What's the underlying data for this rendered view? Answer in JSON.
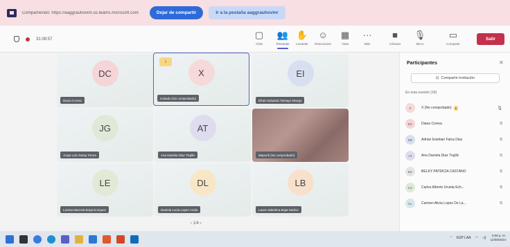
{
  "share_bar": {
    "text": "Compartiendo: https://aaggrauhovinr.us.teams.microsoft.com",
    "stop_label": "Dejar de compartir",
    "goto_label": "Ir a la pestaña aaggrauhovinr"
  },
  "toolbar": {
    "timer": "31:08:57",
    "items": [
      {
        "icon": "chat-icon",
        "glyph": "▢",
        "label": "Chat"
      },
      {
        "icon": "people-icon",
        "glyph": "👥",
        "label": "Personas"
      },
      {
        "icon": "raise-hand-icon",
        "glyph": "✋",
        "label": "Levantar"
      },
      {
        "icon": "reactions-icon",
        "glyph": "☺",
        "label": "Reacciones"
      },
      {
        "icon": "view-icon",
        "glyph": "▦",
        "label": "Vista"
      },
      {
        "icon": "more-icon",
        "glyph": "···",
        "label": "Más"
      },
      {
        "icon": "camera-icon",
        "glyph": "■",
        "label": "Cámara"
      },
      {
        "icon": "mic-icon",
        "glyph": "🎙",
        "label": "Micro"
      },
      {
        "icon": "share-screen-icon",
        "glyph": "▭",
        "label": "Compartir"
      }
    ],
    "leave_label": "Salir"
  },
  "tiles": [
    {
      "initials": "DC",
      "name": "Diana Correa",
      "avatar_color": "#f5d5d8"
    },
    {
      "initials": "X",
      "name": "Invitado (No comprobado)",
      "avatar_color": "#f6d9d9",
      "badge": "1"
    },
    {
      "initials": "EI",
      "name": "Efrain Eduardo Tamayo Aburgo",
      "avatar_color": "#d7dff0"
    },
    {
      "initials": "JG",
      "name": "Jorge Luis Garay Torres",
      "avatar_color": "#dfe9d8"
    },
    {
      "initials": "AT",
      "name": "Ana Daniela Diaz Trujillo",
      "avatar_color": "#dfdcef"
    },
    {
      "initials": "",
      "name": "Maporik (No comprobado)",
      "avatar_color": ""
    },
    {
      "initials": "LE",
      "name": "Lorena Marcela Borja Enriquez",
      "avatar_color": "#e2ead6"
    },
    {
      "initials": "DL",
      "name": "Daniela Lucia Lopez Arcila",
      "avatar_color": "#f7e7c7"
    },
    {
      "initials": "LB",
      "name": "Laura Valentina Bejar Muñoz",
      "avatar_color": "#f7e1cc"
    }
  ],
  "pager": "‹  1/4  ›",
  "panel": {
    "title": "Participantes",
    "close": "✕",
    "invite_label": "Compartir invitación",
    "section": "En esta reunión (18)",
    "participants": [
      {
        "initials": "X",
        "name": "X (No comprobado)",
        "badge": "1",
        "avatar_color": "#f6d9d9"
      },
      {
        "initials": "DC",
        "name": "Diana Correa",
        "avatar_color": "#f5d5d8"
      },
      {
        "initials": "EE",
        "name": "Adrian Esteban Falca Diaz",
        "avatar_color": "#d7dff0"
      },
      {
        "initials": "AT",
        "name": "Ana Daniela Diaz Trujillo",
        "avatar_color": "#dfdcef"
      },
      {
        "initials": "BC",
        "name": "BELKY PATRICIA CASTAÑO",
        "avatar_color": "#e4e4e4"
      },
      {
        "initials": "CA",
        "name": "Carlos Alberto Urueta Ech...",
        "avatar_color": "#dfe9d8"
      },
      {
        "initials": "CL",
        "name": "Carmen Alicia Lopez De La...",
        "avatar_color": "#d6e8ec"
      }
    ]
  },
  "taskbar": {
    "apps": [
      {
        "icon": "windows-icon",
        "color": "#2f6fd6"
      },
      {
        "icon": "search-icon",
        "color": "#333333"
      },
      {
        "icon": "chrome-icon",
        "color": "#3b7be0"
      },
      {
        "icon": "edge-icon",
        "color": "#1f8fd1"
      },
      {
        "icon": "teams-icon",
        "color": "#5b5fc7"
      },
      {
        "icon": "explorer-icon",
        "color": "#e2b33c"
      },
      {
        "icon": "store-icon",
        "color": "#2a7ad1"
      },
      {
        "icon": "brave-icon",
        "color": "#e0582c"
      },
      {
        "icon": "office-icon",
        "color": "#d24726"
      },
      {
        "icon": "outlook-icon",
        "color": "#0f6cbd"
      }
    ],
    "lang": "ESP LAA",
    "time": "5:06 p. m.",
    "date": "12/09/2024"
  }
}
